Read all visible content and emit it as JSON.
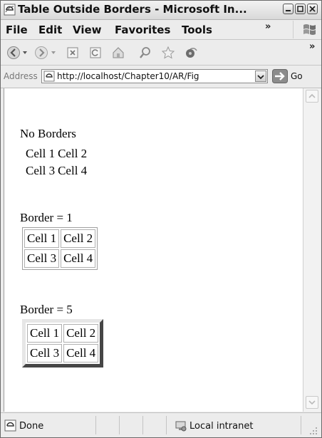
{
  "window": {
    "title": "Table Outside Borders - Microsoft In...",
    "controls": {
      "minimize": "minimize",
      "maximize": "maximize",
      "close": "close"
    }
  },
  "menubar": {
    "items": [
      "File",
      "Edit",
      "View",
      "Favorites",
      "Tools"
    ],
    "overflow": "»"
  },
  "toolbar": {
    "buttons": [
      "back-icon",
      "forward-icon",
      "stop-icon",
      "refresh-icon",
      "home-icon",
      "search-icon",
      "favorites-icon",
      "media-icon"
    ],
    "overflow": "»"
  },
  "address": {
    "label": "Address",
    "url": "http://localhost/Chapter10/AR/Fig",
    "go_label": "Go"
  },
  "page": {
    "section1": {
      "heading": "No Borders",
      "rows": [
        [
          "Cell 1",
          "Cell 2"
        ],
        [
          "Cell 3",
          "Cell 4"
        ]
      ]
    },
    "section2": {
      "heading": "Border = 1",
      "rows": [
        [
          "Cell 1",
          "Cell 2"
        ],
        [
          "Cell 3",
          "Cell 4"
        ]
      ]
    },
    "section3": {
      "heading": "Border = 5",
      "rows": [
        [
          "Cell 1",
          "Cell 2"
        ],
        [
          "Cell 3",
          "Cell 4"
        ]
      ]
    }
  },
  "status": {
    "left": "Done",
    "zone": "Local intranet"
  }
}
